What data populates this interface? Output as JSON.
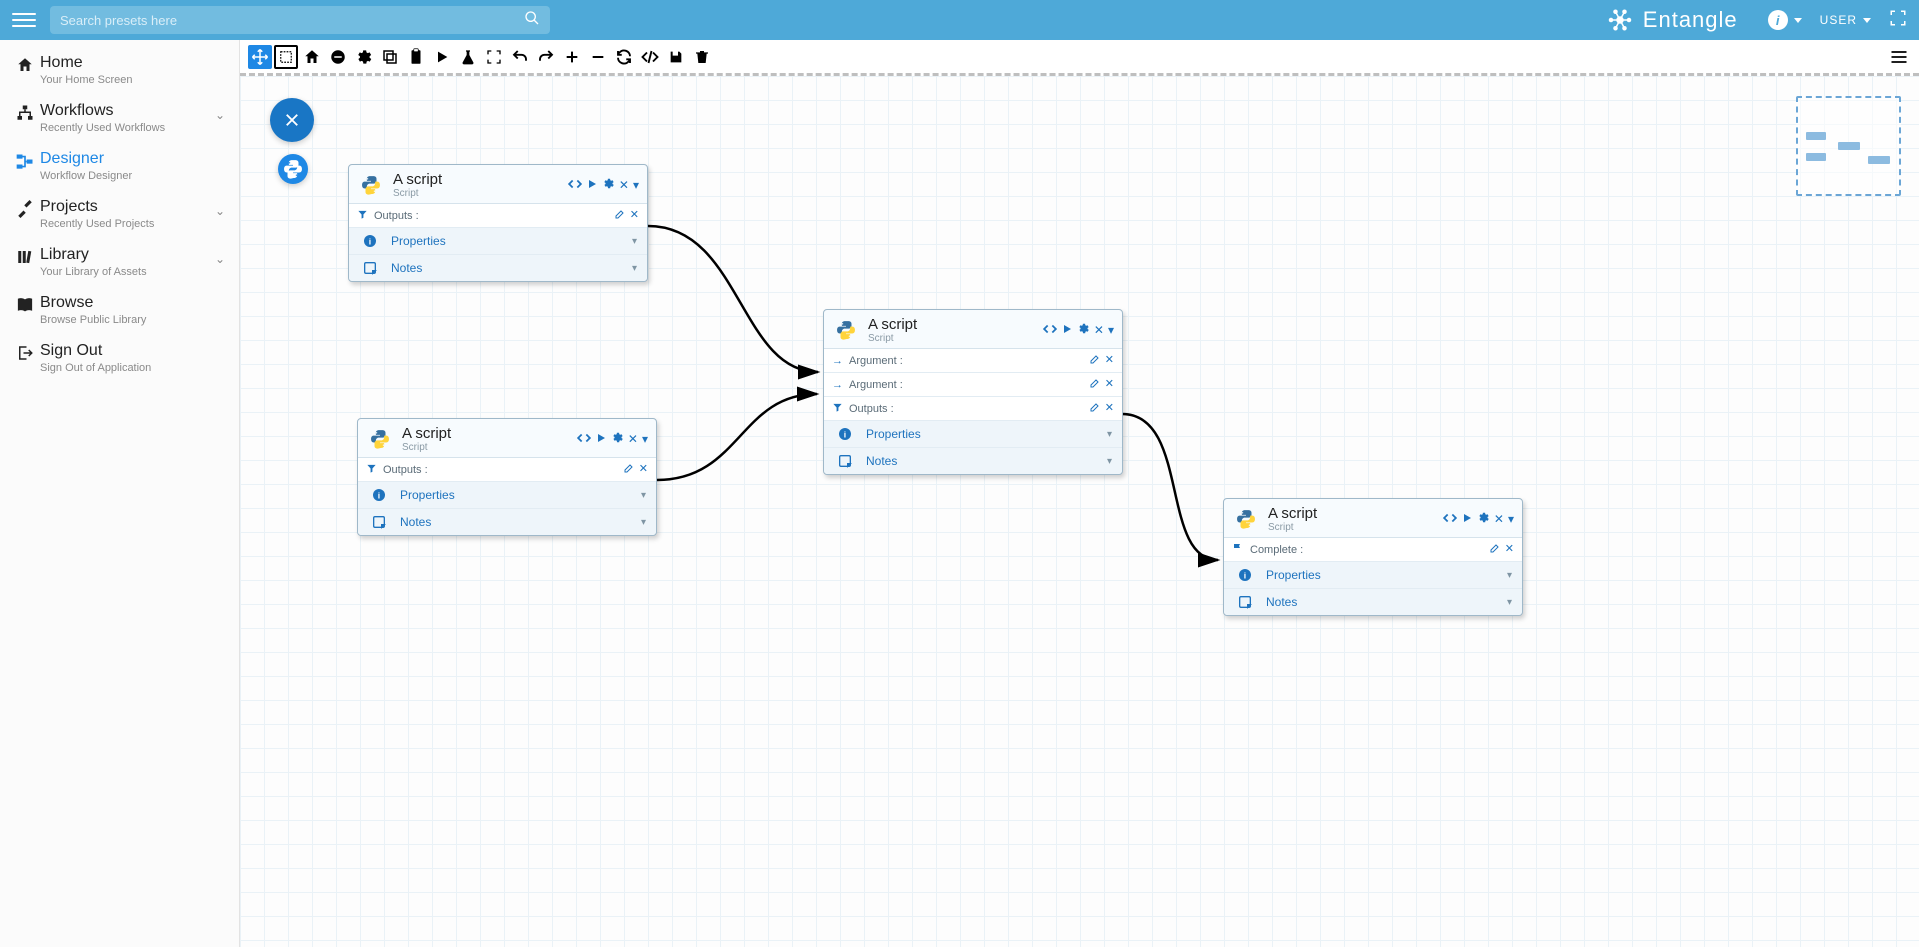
{
  "topbar": {
    "search_placeholder": "Search presets here",
    "brand_text": "Entangle",
    "user_label": "USER"
  },
  "sidebar": {
    "items": [
      {
        "main": "Home",
        "sub": "Your Home Screen",
        "icon": "home",
        "expandable": false,
        "active": false
      },
      {
        "main": "Workflows",
        "sub": "Recently Used Workflows",
        "icon": "flow",
        "expandable": true,
        "active": false
      },
      {
        "main": "Designer",
        "sub": "Workflow Designer",
        "icon": "designer",
        "expandable": false,
        "active": true
      },
      {
        "main": "Projects",
        "sub": "Recently Used Projects",
        "icon": "tools",
        "expandable": true,
        "active": false
      },
      {
        "main": "Library",
        "sub": "Your Library of Assets",
        "icon": "library",
        "expandable": true,
        "active": false
      },
      {
        "main": "Browse",
        "sub": "Browse Public Library",
        "icon": "book",
        "expandable": false,
        "active": false
      },
      {
        "main": "Sign Out",
        "sub": "Sign Out of Application",
        "icon": "signout",
        "expandable": false,
        "active": false
      }
    ]
  },
  "toolbar": {
    "buttons": [
      {
        "name": "move",
        "active": true
      },
      {
        "name": "select",
        "bordered": true
      },
      {
        "name": "home"
      },
      {
        "name": "minus-circle"
      },
      {
        "name": "settings"
      },
      {
        "name": "copy"
      },
      {
        "name": "paste"
      },
      {
        "name": "play"
      },
      {
        "name": "flask"
      },
      {
        "name": "fit"
      },
      {
        "name": "undo"
      },
      {
        "name": "redo"
      },
      {
        "name": "plus"
      },
      {
        "name": "minus"
      },
      {
        "name": "refresh"
      },
      {
        "name": "code"
      },
      {
        "name": "save"
      },
      {
        "name": "delete"
      }
    ]
  },
  "nodes": {
    "n1": {
      "title": "A script",
      "subtitle": "Script",
      "rows": [
        {
          "type": "outputs",
          "label": "Outputs :"
        }
      ],
      "sections": [
        {
          "label": "Properties"
        },
        {
          "label": "Notes"
        }
      ]
    },
    "n2": {
      "title": "A script",
      "subtitle": "Script",
      "rows": [
        {
          "type": "outputs",
          "label": "Outputs :"
        }
      ],
      "sections": [
        {
          "label": "Properties"
        },
        {
          "label": "Notes"
        }
      ]
    },
    "n3": {
      "title": "A script",
      "subtitle": "Script",
      "rows": [
        {
          "type": "argument",
          "label": "Argument :"
        },
        {
          "type": "argument",
          "label": "Argument :"
        },
        {
          "type": "outputs",
          "label": "Outputs :"
        }
      ],
      "sections": [
        {
          "label": "Properties"
        },
        {
          "label": "Notes"
        }
      ]
    },
    "n4": {
      "title": "A script",
      "subtitle": "Script",
      "rows": [
        {
          "type": "complete",
          "label": "Complete :"
        }
      ],
      "sections": [
        {
          "label": "Properties"
        },
        {
          "label": "Notes"
        }
      ]
    }
  }
}
